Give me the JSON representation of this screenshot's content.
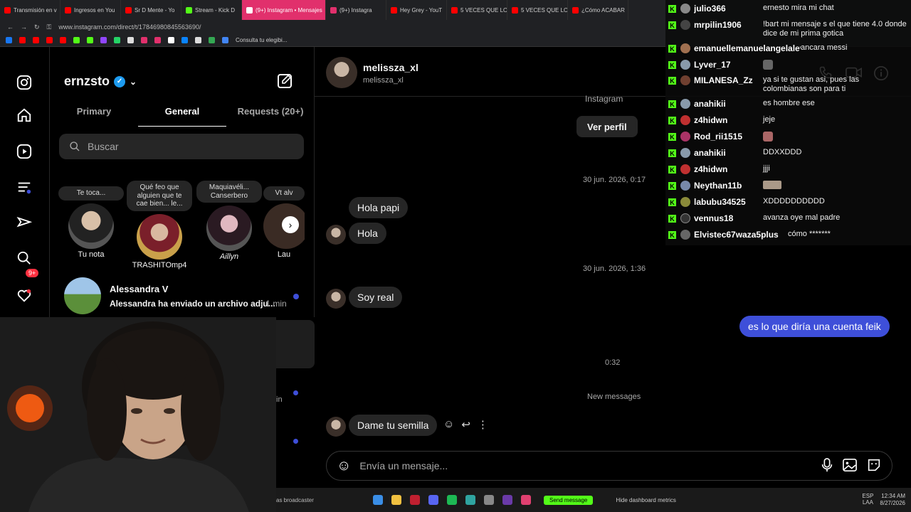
{
  "browser": {
    "tabs": [
      {
        "label": "Transmisión en v",
        "color": "#ff0000"
      },
      {
        "label": "Ingresos en You",
        "color": "#ff0000"
      },
      {
        "label": "Sr D Mente - Yo",
        "color": "#ff0000"
      },
      {
        "label": "Stream - Kick D",
        "color": "#53fc18"
      },
      {
        "label": "(9+) Instagram • Mensajes",
        "color": "#e1306c",
        "active": true
      },
      {
        "label": "(9+) Instagra",
        "color": "#e1306c"
      },
      {
        "label": "Hey Grey - YouT",
        "color": "#ff0000"
      },
      {
        "label": "5 VECES QUE LO",
        "color": "#ff0000"
      },
      {
        "label": "5 VECES QUE LO",
        "color": "#ff0000"
      },
      {
        "label": "¿Cómo ACABAR",
        "color": "#ff0000"
      }
    ],
    "url": "www.instagram.com/direct/t/17846980845563690/",
    "bookmark_label": "Consulta tu elegibi..."
  },
  "inbox": {
    "account": "ernzsto",
    "tabs": [
      "Primary",
      "General",
      "Requests (20+)"
    ],
    "search_placeholder": "Buscar",
    "rail_badge": "9+",
    "stories": [
      {
        "note": "Te toca...",
        "name": "Tu nota"
      },
      {
        "note": "Qué feo que alguien que te cae bien... le...",
        "name": "TRASHITOmp4"
      },
      {
        "note": "Maquiavéli... Canserbero",
        "name": "Aillyn"
      },
      {
        "note": "Vt alv",
        "name": "Lau"
      }
    ],
    "threads": [
      {
        "name": "Alessandra V",
        "preview": "Alessandra ha enviado un archivo adju...",
        "time": "· 1 min"
      }
    ]
  },
  "chat": {
    "name": "melissza_xl",
    "username": "melissza_xl",
    "partial_header": "Instagram",
    "view_profile": "Ver perfil",
    "ts1": "30 jun. 2026, 0:17",
    "ts2": "30 jun. 2026, 1:36",
    "ts3": "0:32",
    "messages": [
      {
        "text": "Hola papi",
        "dir": "in"
      },
      {
        "text": "Hola",
        "dir": "in"
      },
      {
        "text": "Soy real",
        "dir": "in"
      },
      {
        "text": "es lo que diría una cuenta feik",
        "dir": "out"
      },
      {
        "text": "Dame tu semilla",
        "dir": "in"
      }
    ],
    "new_messages": "New messages",
    "composer_placeholder": "Envía un mensaje..."
  },
  "stream_chat": [
    {
      "user": "julio366",
      "text": "ernesto mira mi chat"
    },
    {
      "user": "mrpilin1906",
      "text": "!bart mi mensaje s el que tiene 4.0 donde dice de mi prima gotica"
    },
    {
      "user": "emanuellemanuelangelalev",
      "text": "ancara messi"
    },
    {
      "user": "Lyver_17",
      "text": ""
    },
    {
      "user": "MILANESA_Zz",
      "text": "ya si te gustan asi, pues las colombianas son para ti"
    },
    {
      "user": "anahikii",
      "text": "es hombre ese"
    },
    {
      "user": "z4hidwn",
      "text": "jeje"
    },
    {
      "user": "Rod_rii1515",
      "text": ""
    },
    {
      "user": "anahikii",
      "text": "DDXXDDD"
    },
    {
      "user": "z4hidwn",
      "text": "jjji"
    },
    {
      "user": "Neythan11b",
      "text": ""
    },
    {
      "user": "labubu34525",
      "text": "XDDDDDDDDDD"
    },
    {
      "user": "vennus18",
      "text": "avanza oye mal padre"
    },
    {
      "user": "Elvistec67waza5plus",
      "text": "cómo *******"
    }
  ],
  "taskbar": {
    "broadcaster": "as broadcaster",
    "send_message": "Send message",
    "hide_metrics": "Hide dashboard metrics",
    "lang": "ESP LAA",
    "time": "12:34 AM",
    "date": "8/27/2026"
  }
}
